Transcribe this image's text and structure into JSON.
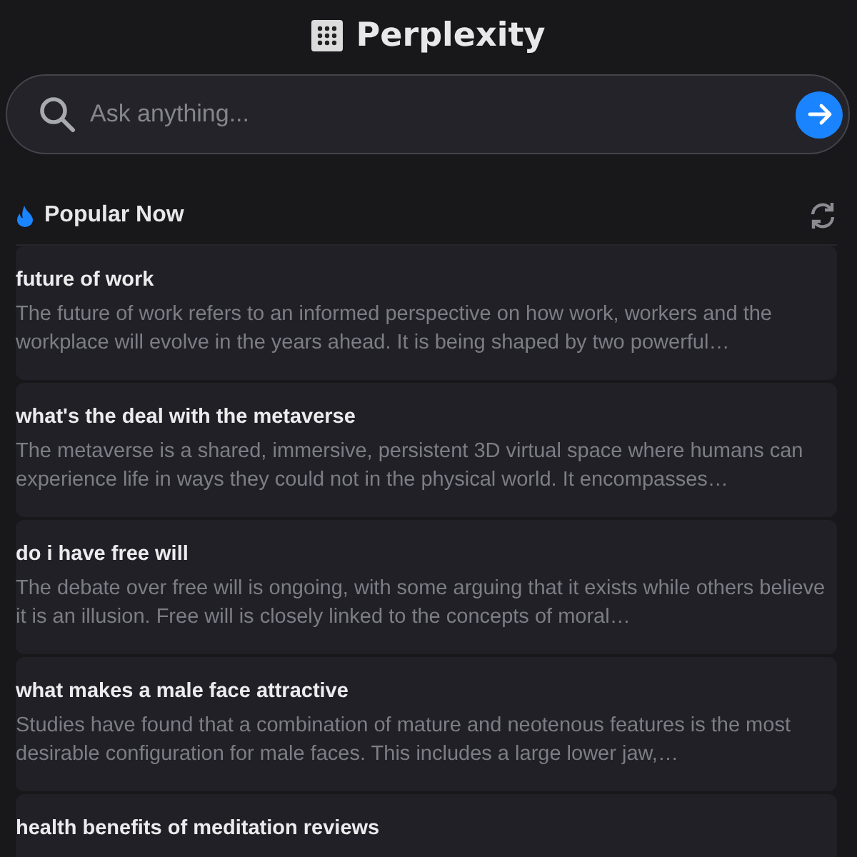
{
  "header": {
    "title": "Perplexity"
  },
  "search": {
    "placeholder": "Ask anything..."
  },
  "section": {
    "title": "Popular Now"
  },
  "cards": [
    {
      "title": "future of work",
      "summary": "The future of work refers to an informed perspective on how work, workers and the workplace will evolve in the years ahead. It is being shaped by two powerful…"
    },
    {
      "title": "what's the deal with the metaverse",
      "summary": "The metaverse is a shared, immersive, persistent 3D virtual space where humans can experience life in ways they could not in the physical world. It encompasses…"
    },
    {
      "title": "do i have free will",
      "summary": "The debate over free will is ongoing, with some arguing that it exists while others believe it is an illusion. Free will is closely linked to the concepts of moral…"
    },
    {
      "title": "what makes a male face attractive",
      "summary": "Studies have found that a combination of mature and neotenous features is the most desirable configuration for male faces. This includes a large lower jaw,…"
    },
    {
      "title": "health benefits of meditation reviews"
    }
  ]
}
